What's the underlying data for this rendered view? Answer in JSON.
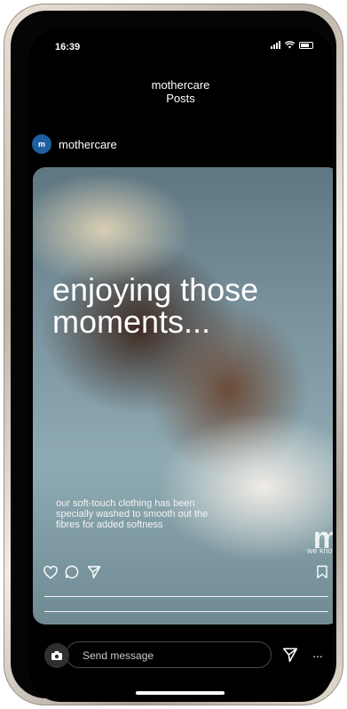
{
  "status_bar": {
    "time": "16:39"
  },
  "header": {
    "title": "mothercare",
    "subtitle": "Posts"
  },
  "profile": {
    "avatar_text": "m",
    "username": "mothercare"
  },
  "post": {
    "image_headline": "enjoying those moments...",
    "image_body": "our soft-touch clothing has been specially washed to smooth out the fibres for added softness",
    "brand_mark": "m",
    "brand_tagline": "we know"
  },
  "actions": {
    "like_icon": "heart-outline",
    "comment_icon": "speech-bubble-outline",
    "share_icon": "paper-plane-outline",
    "save_icon": "bookmark-outline"
  },
  "composer": {
    "placeholder": "Send message",
    "camera_icon": "camera-icon",
    "send_icon": "paper-plane-icon",
    "more_label": "..."
  }
}
